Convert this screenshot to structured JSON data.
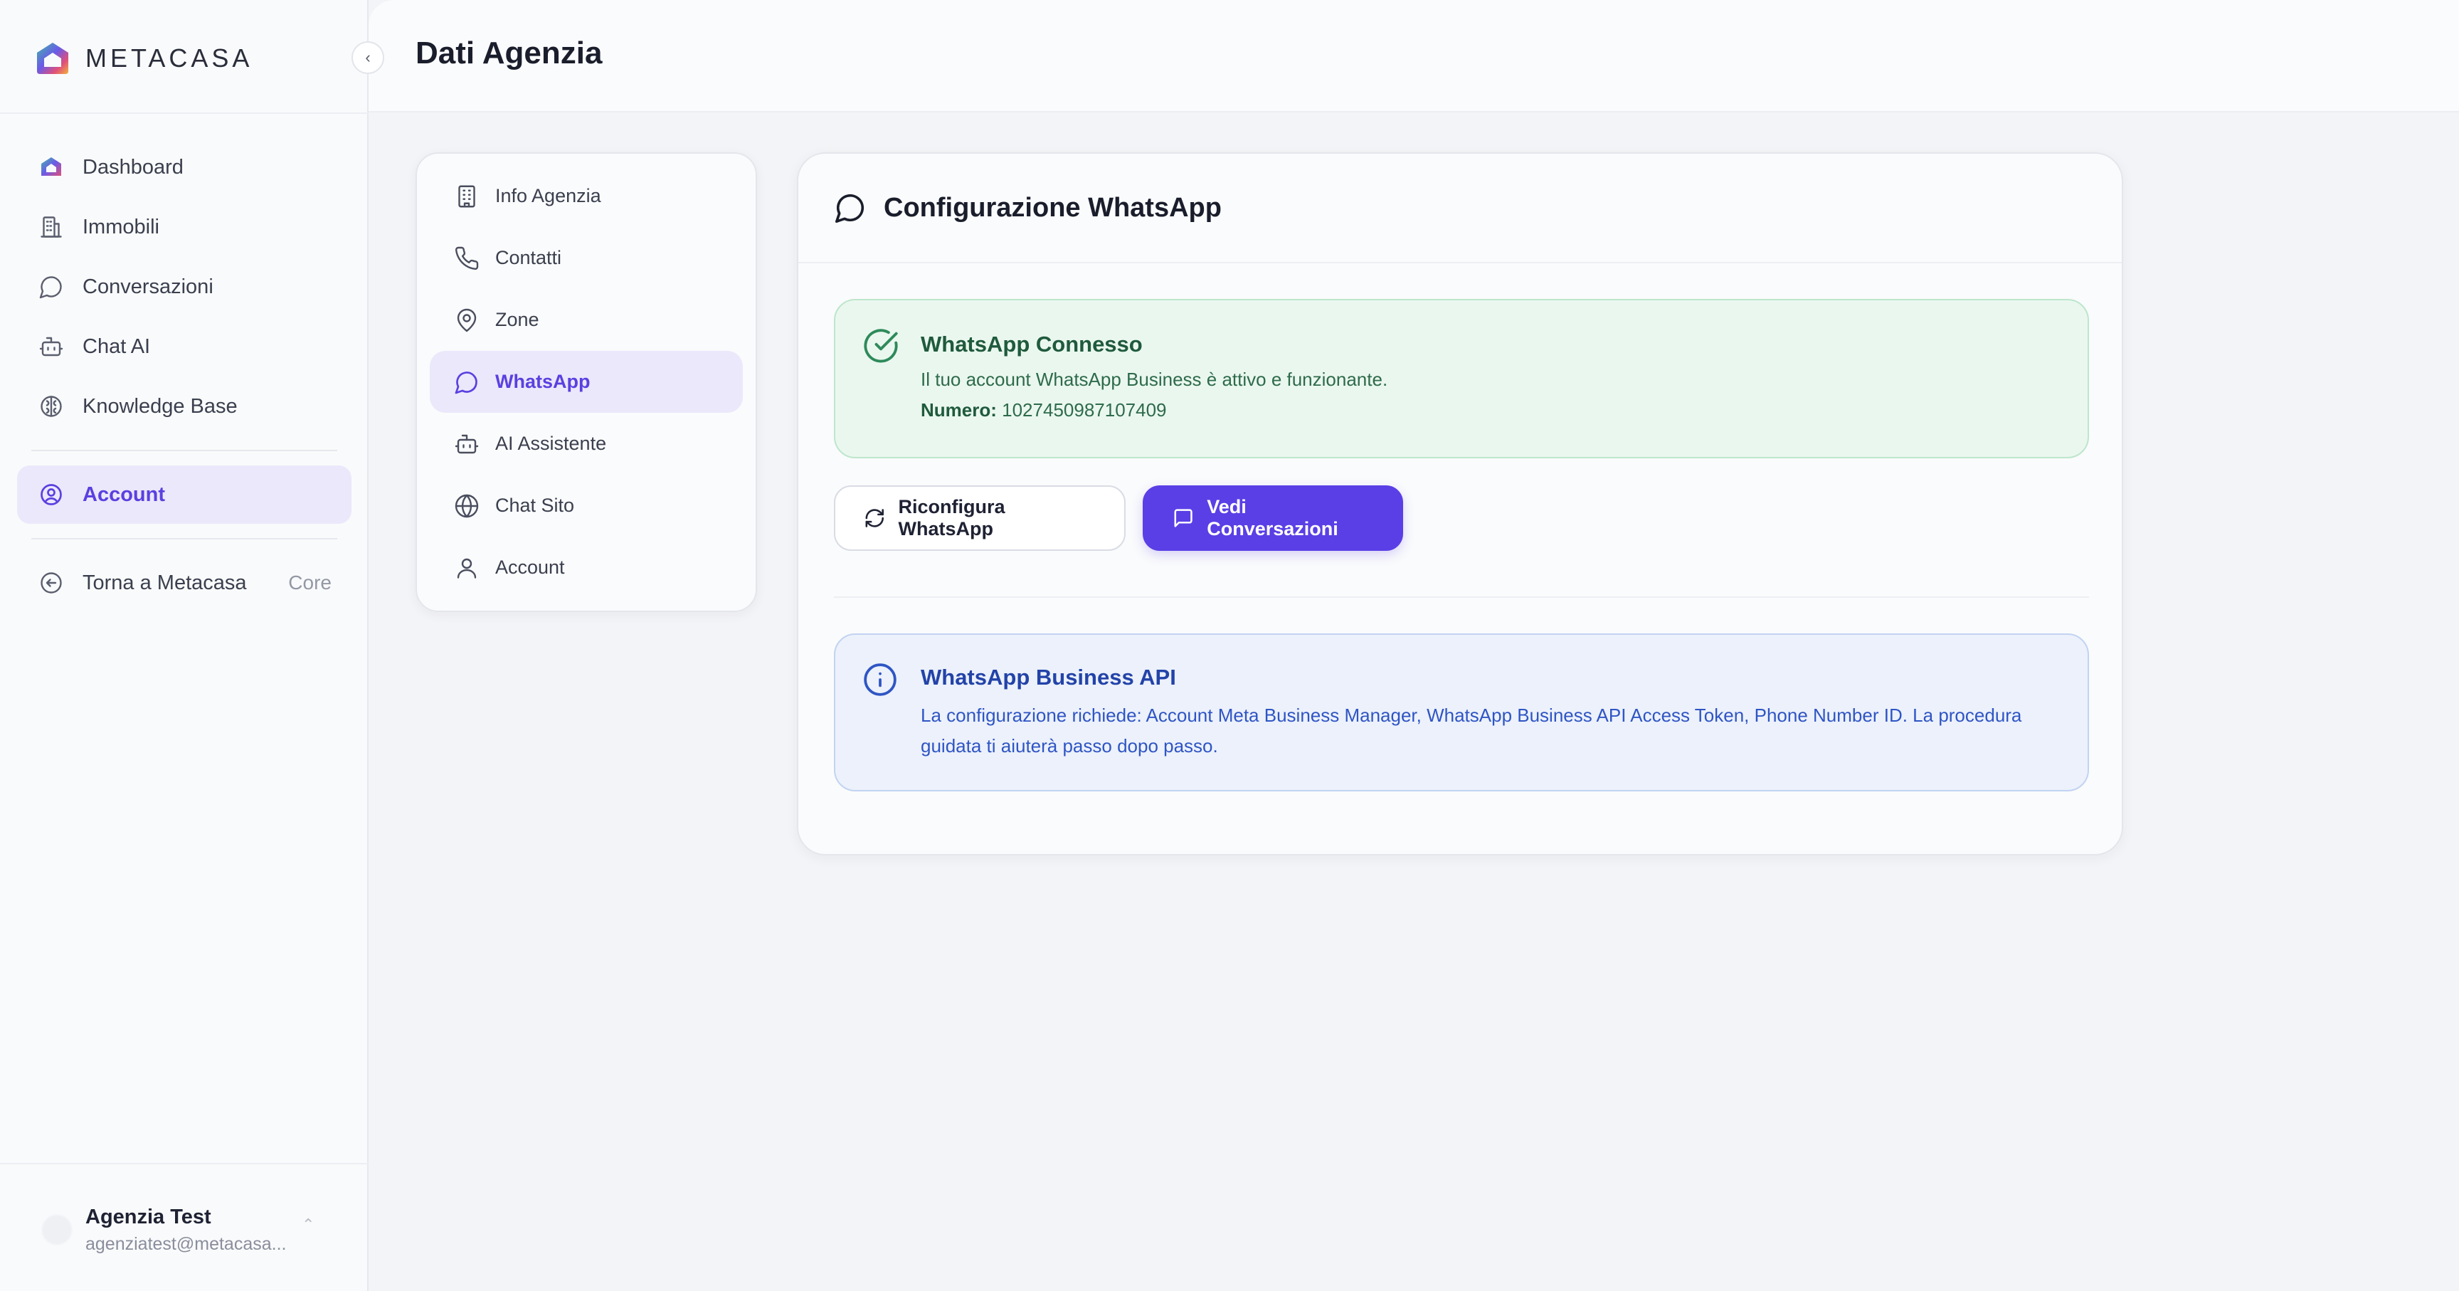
{
  "brand": {
    "name": "METACASA",
    "logo_icon": "metacasa-house-logo"
  },
  "colors": {
    "accent": "#5a3fe6",
    "success_bg": "#eaf7ef",
    "info_bg": "#ecf1fb"
  },
  "sidebar": {
    "items": [
      {
        "label": "Dashboard",
        "icon": "house-logo-icon"
      },
      {
        "label": "Immobili",
        "icon": "building-icon"
      },
      {
        "label": "Conversazioni",
        "icon": "chat-bubble-icon"
      },
      {
        "label": "Chat AI",
        "icon": "robot-icon"
      },
      {
        "label": "Knowledge Base",
        "icon": "brain-icon"
      }
    ],
    "account_label": "Account",
    "back_label": "Torna a Metacasa",
    "back_badge": "Core"
  },
  "user": {
    "name": "Agenzia Test",
    "email": "agenziatest@metacasa..."
  },
  "header": {
    "title": "Dati Agenzia"
  },
  "submenu": {
    "items": [
      {
        "label": "Info Agenzia",
        "icon": "building-icon"
      },
      {
        "label": "Contatti",
        "icon": "phone-icon"
      },
      {
        "label": "Zone",
        "icon": "map-pin-icon"
      },
      {
        "label": "WhatsApp",
        "icon": "chat-bubble-icon",
        "active": true
      },
      {
        "label": "AI Assistente",
        "icon": "robot-icon"
      },
      {
        "label": "Chat Sito",
        "icon": "globe-icon"
      },
      {
        "label": "Account",
        "icon": "user-icon"
      }
    ]
  },
  "card": {
    "title": "Configurazione WhatsApp",
    "status": {
      "title": "WhatsApp Connesso",
      "description": "Il tuo account WhatsApp Business è attivo e funzionante.",
      "number_label": "Numero:",
      "number_value": "1027450987107409"
    },
    "buttons": {
      "reconfigure": "Riconfigura WhatsApp",
      "view_conversations": "Vedi Conversazioni"
    },
    "info": {
      "title": "WhatsApp Business API",
      "description": "La configurazione richiede: Account Meta Business Manager, WhatsApp Business API Access Token, Phone Number ID. La procedura guidata ti aiuterà passo dopo passo."
    }
  }
}
